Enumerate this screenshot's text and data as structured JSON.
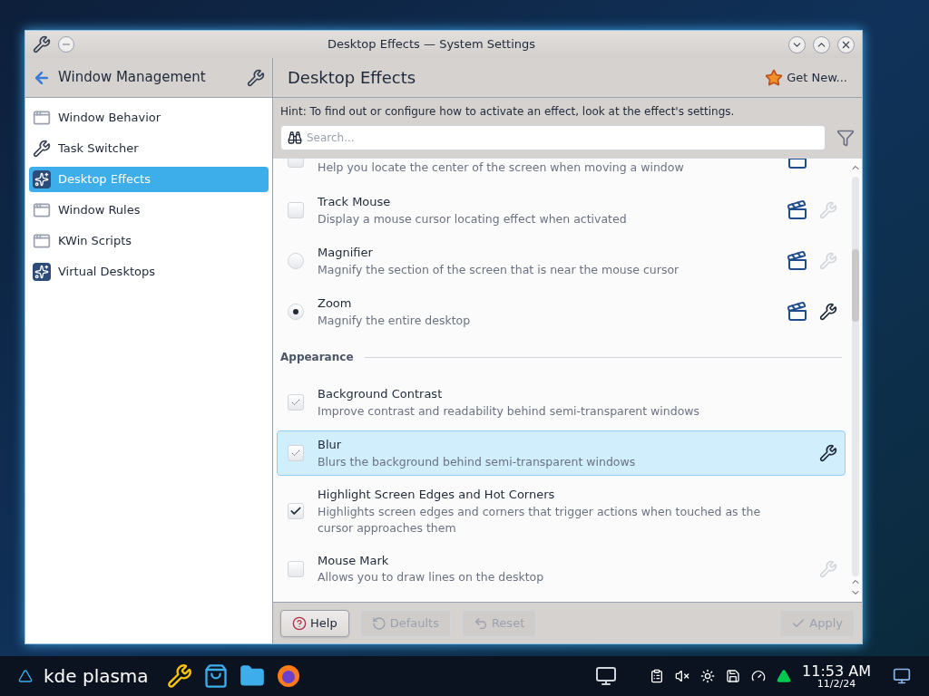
{
  "window": {
    "title": "Desktop Effects — System Settings"
  },
  "sidebar": {
    "header": "Window Management",
    "items": [
      {
        "label": "Window Behavior",
        "kind": "window",
        "selected": false
      },
      {
        "label": "Task Switcher",
        "kind": "tools",
        "selected": false
      },
      {
        "label": "Desktop Effects",
        "kind": "effects",
        "selected": true
      },
      {
        "label": "Window Rules",
        "kind": "window",
        "selected": false
      },
      {
        "label": "KWin Scripts",
        "kind": "window",
        "selected": false
      },
      {
        "label": "Virtual Desktops",
        "kind": "effects",
        "selected": false
      }
    ]
  },
  "page": {
    "title": "Desktop Effects",
    "get_new": "Get New...",
    "hint": "Hint: To find out or configure how to activate an effect, look at the effect's settings.",
    "search": {
      "placeholder": "Search..."
    }
  },
  "effects": [
    {
      "kind": "checkbox",
      "description": "Help you locate the center of the screen when moving a window",
      "checked": false,
      "video": true,
      "settings_button": false,
      "selected": false
    },
    {
      "kind": "checkbox",
      "title": "Track Mouse",
      "description": "Display a mouse cursor locating effect when activated",
      "checked": false,
      "video": true,
      "settings_button": true,
      "settings_disabled": true,
      "selected": false
    },
    {
      "kind": "radio",
      "title": "Magnifier",
      "description": "Magnify the section of the screen that is near the mouse cursor",
      "checked": false,
      "video": true,
      "settings_button": true,
      "settings_disabled": true,
      "selected": false
    },
    {
      "kind": "radio",
      "title": "Zoom",
      "description": "Magnify the entire desktop",
      "checked": true,
      "video": true,
      "settings_button": true,
      "settings_disabled": false,
      "selected": false
    },
    {
      "kind": "section",
      "title": "Appearance"
    },
    {
      "kind": "checkbox",
      "title": "Background Contrast",
      "description": "Improve contrast and readability behind semi-transparent windows",
      "checked": true,
      "partial": true,
      "video": false,
      "settings_button": false,
      "selected": false
    },
    {
      "kind": "checkbox",
      "title": "Blur",
      "description": "Blurs the background behind semi-transparent windows",
      "checked": true,
      "partial": true,
      "video": false,
      "settings_button": true,
      "settings_disabled": false,
      "selected": true
    },
    {
      "kind": "checkbox",
      "title": "Highlight Screen Edges and Hot Corners",
      "description": "Highlights screen edges and corners that trigger actions when touched as the cursor approaches them",
      "checked": true,
      "partial": false,
      "video": false,
      "settings_button": false,
      "selected": false
    },
    {
      "kind": "checkbox",
      "title": "Mouse Mark",
      "description": "Allows you to draw lines on the desktop",
      "checked": false,
      "video": false,
      "settings_button": true,
      "settings_disabled": true,
      "selected": false
    }
  ],
  "buttons": [
    {
      "label": "Help",
      "disabled": false
    },
    {
      "label": "Defaults",
      "disabled": true
    },
    {
      "label": "Reset",
      "disabled": true
    },
    {
      "label": "Apply",
      "disabled": true
    }
  ],
  "taskbar": {
    "launcher": "kde plasma",
    "clock": {
      "time": "11:53 AM",
      "date": "11/2/24"
    }
  }
}
